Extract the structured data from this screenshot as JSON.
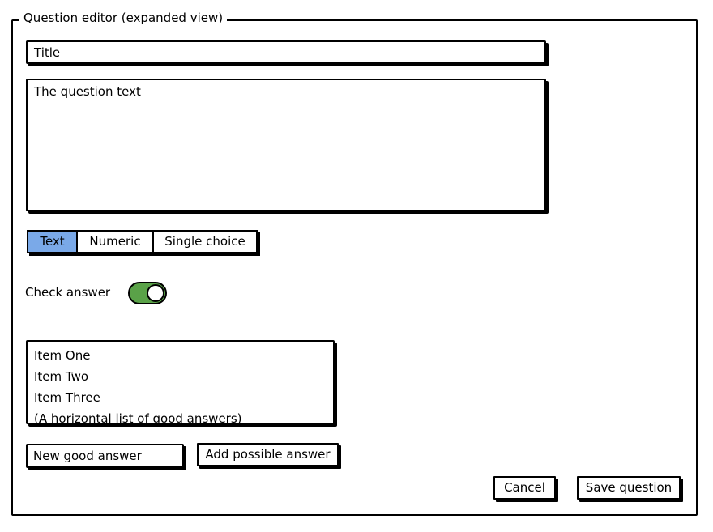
{
  "editor": {
    "legend": "Question editor (expanded view)",
    "title_value": "Title",
    "question_text_value": "The question text",
    "type_tabs": [
      {
        "label": "Text",
        "selected": true
      },
      {
        "label": "Numeric",
        "selected": false
      },
      {
        "label": "Single choice",
        "selected": false
      }
    ],
    "check_answer_label": "Check answer",
    "check_answer_on": true,
    "toggle_color": "#5aa248",
    "selected_tab_color": "#7aa9e8",
    "answers": [
      "Item One",
      "Item Two",
      "Item Three",
      "(A horizontal list of good answers)"
    ],
    "new_answer_value": "New good answer",
    "add_button_label": "Add possible answer",
    "cancel_label": "Cancel",
    "save_label": "Save question"
  }
}
